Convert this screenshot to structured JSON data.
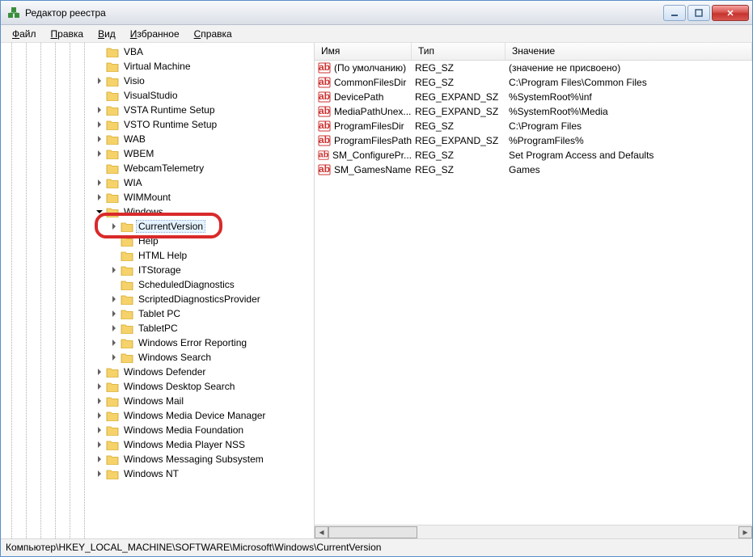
{
  "window": {
    "title": "Редактор реестра"
  },
  "menu": {
    "file": "Файл",
    "edit": "Правка",
    "view": "Вид",
    "favorites": "Избранное",
    "help": "Справка"
  },
  "tree": {
    "prefix_depth": 5,
    "items_level6": [
      {
        "label": "VBA",
        "exp": null
      },
      {
        "label": "Virtual Machine",
        "exp": null
      },
      {
        "label": "Visio",
        "exp": "closed"
      },
      {
        "label": "VisualStudio",
        "exp": null
      },
      {
        "label": "VSTA Runtime Setup",
        "exp": "closed"
      },
      {
        "label": "VSTO Runtime Setup",
        "exp": "closed"
      },
      {
        "label": "WAB",
        "exp": "closed"
      },
      {
        "label": "WBEM",
        "exp": "closed"
      },
      {
        "label": "WebcamTelemetry",
        "exp": null
      },
      {
        "label": "WIA",
        "exp": "closed"
      },
      {
        "label": "WIMMount",
        "exp": "closed"
      }
    ],
    "windows_label": "Windows",
    "windows_children": [
      {
        "label": "CurrentVersion",
        "exp": "closed",
        "selected": true
      },
      {
        "label": "Help",
        "exp": null
      },
      {
        "label": "HTML Help",
        "exp": null
      },
      {
        "label": "ITStorage",
        "exp": "closed"
      },
      {
        "label": "ScheduledDiagnostics",
        "exp": null
      },
      {
        "label": "ScriptedDiagnosticsProvider",
        "exp": "closed"
      },
      {
        "label": "Tablet PC",
        "exp": "closed"
      },
      {
        "label": "TabletPC",
        "exp": "closed"
      },
      {
        "label": "Windows Error Reporting",
        "exp": "closed"
      },
      {
        "label": "Windows Search",
        "exp": "closed"
      }
    ],
    "items_level6_after": [
      {
        "label": "Windows Defender",
        "exp": "closed"
      },
      {
        "label": "Windows Desktop Search",
        "exp": "closed"
      },
      {
        "label": "Windows Mail",
        "exp": "closed"
      },
      {
        "label": "Windows Media Device Manager",
        "exp": "closed"
      },
      {
        "label": "Windows Media Foundation",
        "exp": "closed"
      },
      {
        "label": "Windows Media Player NSS",
        "exp": "closed"
      },
      {
        "label": "Windows Messaging Subsystem",
        "exp": "closed"
      },
      {
        "label": "Windows NT",
        "exp": "closed"
      }
    ]
  },
  "columns": {
    "name": "Имя",
    "type": "Тип",
    "data": "Значение"
  },
  "values": [
    {
      "name": "(По умолчанию)",
      "type": "REG_SZ",
      "data": "(значение не присвоено)"
    },
    {
      "name": "CommonFilesDir",
      "type": "REG_SZ",
      "data": "C:\\Program Files\\Common Files"
    },
    {
      "name": "DevicePath",
      "type": "REG_EXPAND_SZ",
      "data": "%SystemRoot%\\inf"
    },
    {
      "name": "MediaPathUnex...",
      "type": "REG_EXPAND_SZ",
      "data": "%SystemRoot%\\Media"
    },
    {
      "name": "ProgramFilesDir",
      "type": "REG_SZ",
      "data": "C:\\Program Files"
    },
    {
      "name": "ProgramFilesPath",
      "type": "REG_EXPAND_SZ",
      "data": "%ProgramFiles%"
    },
    {
      "name": "SM_ConfigurePr...",
      "type": "REG_SZ",
      "data": "Set Program Access and Defaults"
    },
    {
      "name": "SM_GamesName",
      "type": "REG_SZ",
      "data": "Games"
    }
  ],
  "status": "Компьютер\\HKEY_LOCAL_MACHINE\\SOFTWARE\\Microsoft\\Windows\\CurrentVersion"
}
